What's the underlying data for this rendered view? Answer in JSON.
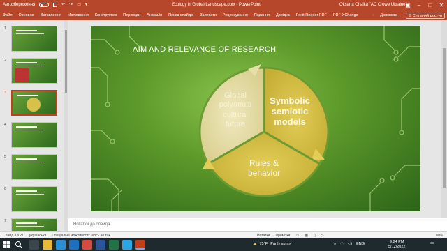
{
  "titlebar": {
    "autosave": "Автозбереження",
    "toggle_state": "Вимк",
    "doc_title": "Ecology in Global Landscape.pptx - PowerPoint",
    "user": "Oksana Chaika \"AC Crowe Ukraine\""
  },
  "ribbon": {
    "tabs": [
      "Файл",
      "Основне",
      "Вставлення",
      "Малювання",
      "Конструктор",
      "Переходи",
      "Анімація",
      "Показ слайдів",
      "Записати",
      "Рецензування",
      "Подання",
      "Довідка",
      "Foxit Reader PDF",
      "PDF-XChange"
    ],
    "tell_me": "Допомога",
    "share": "Спільний доступ"
  },
  "thumbnails": {
    "numbers": [
      "1",
      "2",
      "3",
      "4",
      "5",
      "6",
      "7"
    ]
  },
  "slide": {
    "title": "AIM AND RELEVANCE OF RESEARCH",
    "segments": {
      "left": [
        "Global",
        "poly/multi",
        "cultural",
        "future"
      ],
      "right": [
        "Symbolic",
        "semiotic",
        "models"
      ],
      "bottom": [
        "Rules &",
        "behavior"
      ]
    }
  },
  "notes": {
    "placeholder": "Нотатки до слайда"
  },
  "statusbar": {
    "slide_count": "Слайд 3 з 21",
    "language": "українська",
    "accessibility": "Спеціальні можливості: щось не так",
    "notes_btn": "Нотатки",
    "comments_btn": "Примітки",
    "zoom": "80%"
  },
  "taskbar": {
    "temp": "75°F",
    "weather": "Partly sunny",
    "lang": "ENG",
    "time": "9:24 PM",
    "date": "5/12/2022"
  },
  "colors": {
    "accent": "#b7472a",
    "slide_green": "#5d9a2a",
    "segment_yellow": "#d7c14c",
    "segment_cream": "#ece5b4"
  }
}
